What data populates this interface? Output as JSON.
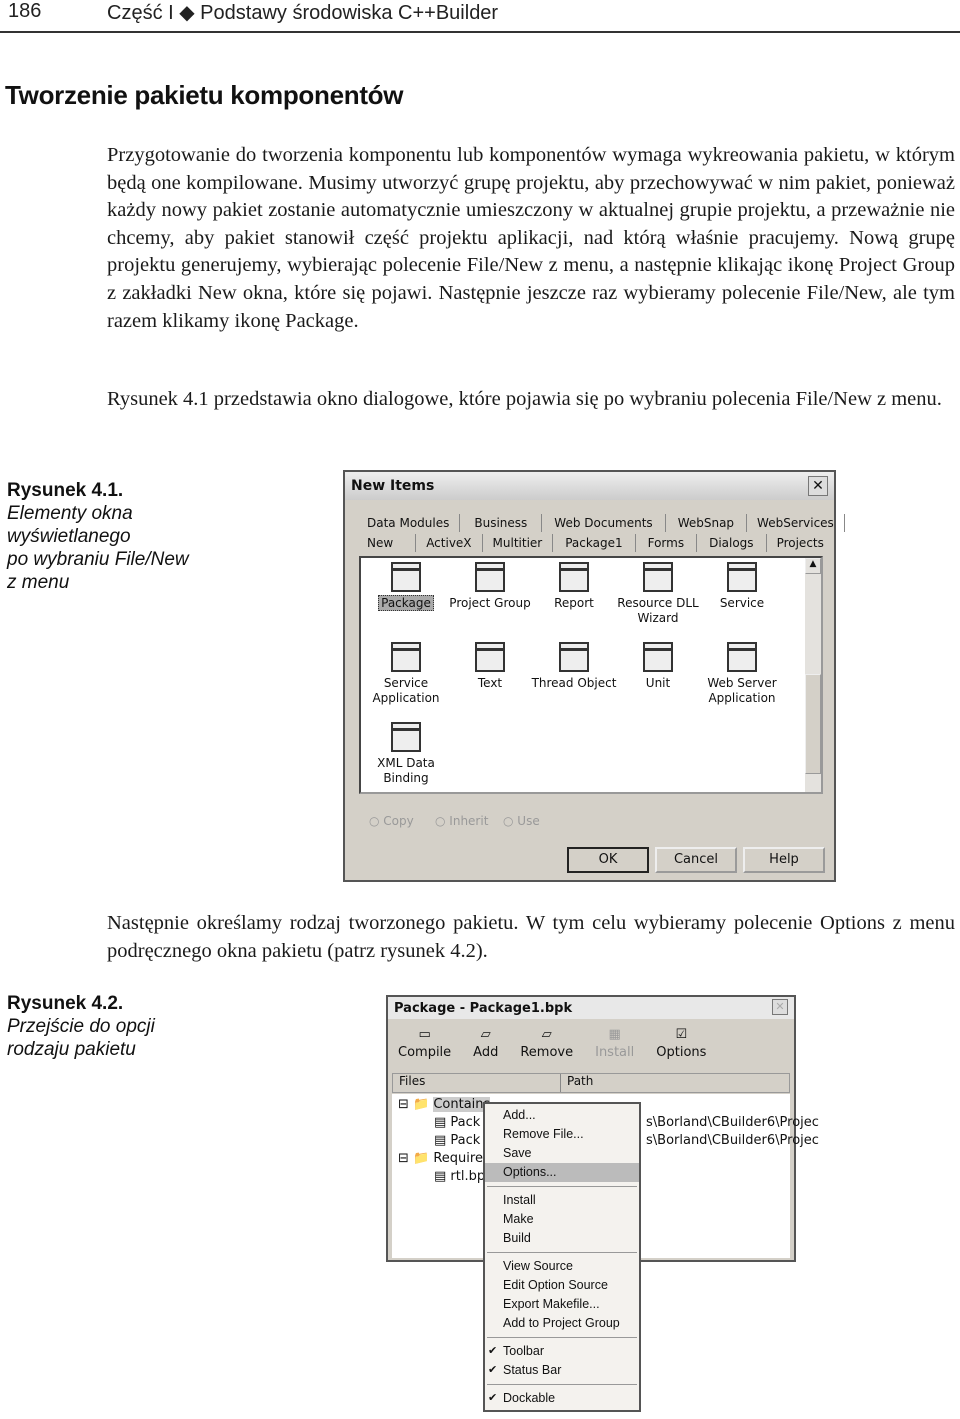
{
  "header": {
    "page_number": "186",
    "section": "Część I ◆ Podstawy środowiska C++Builder"
  },
  "heading": "Tworzenie pakietu komponentów",
  "paragraphs": [
    "Przygotowanie do tworzenia komponentu lub komponentów wymaga wykreowania pakietu, w którym będą one kompilowane. Musimy utworzyć grupę projektu, aby przechowywać w nim pakiet, ponieważ każdy nowy pakiet zostanie automatycznie umieszczony w aktualnej grupie projektu, a przeważnie nie chcemy, aby pakiet stanowił część projektu aplikacji, nad którą właśnie pracujemy. Nową grupę projektu generujemy, wybierając polecenie File/New z menu, a następnie klikając ikonę Project Group z zakładki New okna, które się pojawi. Następnie jeszcze raz wybieramy polecenie File/New, ale tym razem klikamy ikonę Package.",
    "Rysunek 4.1 przedstawia okno dialogowe, które pojawia się po wybraniu polecenia File/New z menu.",
    "Następnie określamy rodzaj tworzonego pakietu. W tym celu wybieramy polecenie Options z menu podręcznego okna pakietu (patrz rysunek 4.2)."
  ],
  "figures": [
    {
      "label": "Rysunek 4.1.",
      "caption_lines": [
        "Elementy okna",
        "wyświetlanego",
        "po wybraniu File/New",
        "z menu"
      ]
    },
    {
      "label": "Rysunek 4.2.",
      "caption_lines": [
        "Przejście do opcji",
        "rodzaju pakietu"
      ]
    }
  ],
  "new_items": {
    "title": "New Items",
    "tabs_back": [
      "Data Modules",
      "Business",
      "Web Documents",
      "WebSnap",
      "WebServices"
    ],
    "tabs_front": [
      "New",
      "ActiveX",
      "Multitier",
      "Package1",
      "Forms",
      "Dialogs",
      "Projects"
    ],
    "items": [
      "Package",
      "Project Group",
      "Report",
      "Resource DLL Wizard",
      "Service",
      "Service Application",
      "Text",
      "Thread Object",
      "Unit",
      "Web Server Application",
      "XML Data Binding"
    ],
    "radios": [
      "Copy",
      "Inherit",
      "Use"
    ],
    "buttons": [
      "OK",
      "Cancel",
      "Help"
    ]
  },
  "package_window": {
    "title": "Package - Package1.bpk",
    "toolbar": [
      "Compile",
      "Add",
      "Remove",
      "Install",
      "Options"
    ],
    "columns": [
      "Files",
      "Path"
    ],
    "tree": [
      "Contains",
      "Pack",
      "Pack",
      "Requires",
      "rtl.bp"
    ],
    "paths": [
      "s\\Borland\\CBuilder6\\Projec",
      "s\\Borland\\CBuilder6\\Projec"
    ],
    "menu": [
      [
        "Add...",
        "Remove File...",
        "Save",
        "Options..."
      ],
      [
        "Install",
        "Make",
        "Build"
      ],
      [
        "View Source",
        "Edit Option Source",
        "Export Makefile...",
        "Add to Project Group"
      ],
      [
        "Toolbar",
        "Status Bar"
      ],
      [
        "Dockable"
      ]
    ]
  }
}
